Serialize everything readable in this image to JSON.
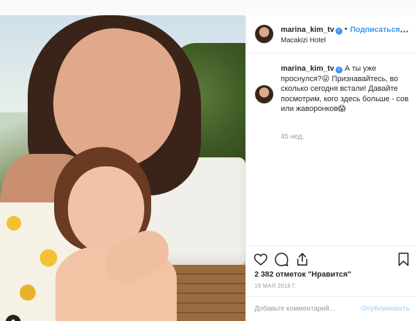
{
  "post": {
    "username": "marina_kim_tv",
    "verified_icon": "verified-badge-icon",
    "separator": "•",
    "follow_label": "Подписаться",
    "location": "Macakizi Hotel",
    "more_icon": "ellipsis-icon",
    "caption_username": "marina_kim_tv",
    "caption_text": "А ты уже проснулся?😜 Признавайтесь, во сколько сегодня встали! Давайте посмотрим, кого здесь больше - сов или жаворонков😱",
    "age": "45 нед.",
    "likes": "2 382 отметок \"Нравится\"",
    "date": "19 МАЯ 2018 Г.",
    "comment_placeholder": "Добавьте комментарий...",
    "publish_label": "Опубликовать"
  },
  "icons": {
    "like": "heart-icon",
    "comment": "comment-icon",
    "share": "share-icon",
    "save": "bookmark-icon",
    "tag": "user-tag-icon"
  },
  "colors": {
    "accent": "#3897f0",
    "publish_disabled": "#b3dbff",
    "muted": "#999999",
    "text": "#262626"
  }
}
